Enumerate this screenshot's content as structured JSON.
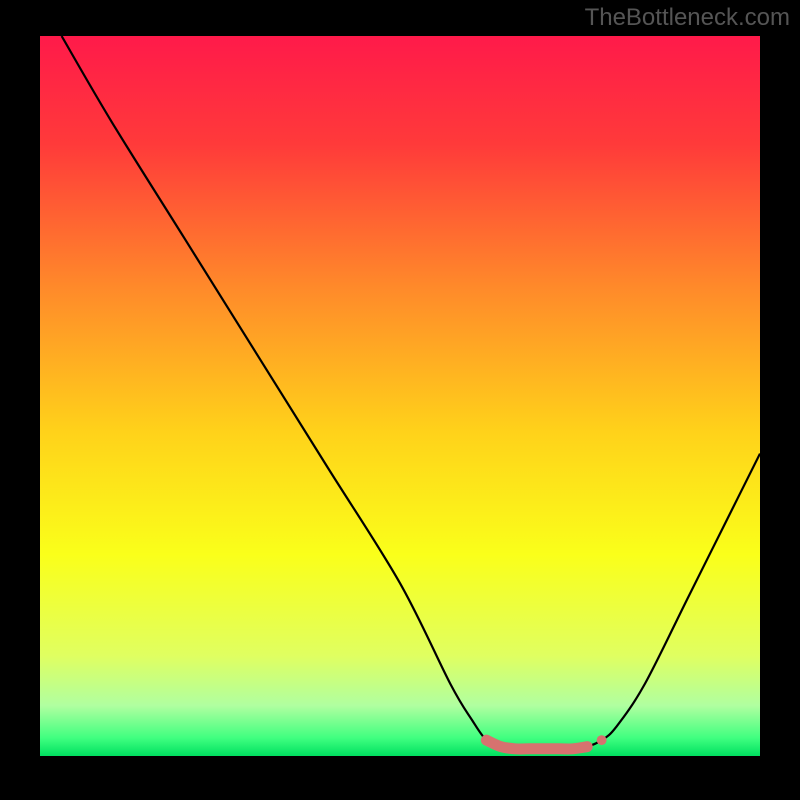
{
  "watermark": "TheBottleneck.com",
  "chart_data": {
    "type": "line",
    "title": "",
    "xlabel": "",
    "ylabel": "",
    "xlim": [
      0,
      100
    ],
    "ylim": [
      0,
      100
    ],
    "background_gradient": {
      "stops": [
        {
          "offset": 0.0,
          "color": "#ff1a4a"
        },
        {
          "offset": 0.15,
          "color": "#ff3a3a"
        },
        {
          "offset": 0.35,
          "color": "#ff8a2a"
        },
        {
          "offset": 0.55,
          "color": "#ffd21a"
        },
        {
          "offset": 0.72,
          "color": "#faff1a"
        },
        {
          "offset": 0.86,
          "color": "#e0ff60"
        },
        {
          "offset": 0.93,
          "color": "#b0ffa0"
        },
        {
          "offset": 0.975,
          "color": "#40ff80"
        },
        {
          "offset": 1.0,
          "color": "#00e060"
        }
      ]
    },
    "series": [
      {
        "name": "bottleneck-curve",
        "color": "#000000",
        "width": 2.2,
        "points": [
          {
            "x": 3,
            "y": 100
          },
          {
            "x": 10,
            "y": 88
          },
          {
            "x": 20,
            "y": 72
          },
          {
            "x": 30,
            "y": 56
          },
          {
            "x": 40,
            "y": 40
          },
          {
            "x": 50,
            "y": 24
          },
          {
            "x": 57,
            "y": 10
          },
          {
            "x": 60,
            "y": 5
          },
          {
            "x": 62,
            "y": 2.2
          },
          {
            "x": 64,
            "y": 1.3
          },
          {
            "x": 66,
            "y": 1.0
          },
          {
            "x": 70,
            "y": 1.0
          },
          {
            "x": 74,
            "y": 1.0
          },
          {
            "x": 76,
            "y": 1.3
          },
          {
            "x": 78,
            "y": 2.2
          },
          {
            "x": 80,
            "y": 4
          },
          {
            "x": 84,
            "y": 10
          },
          {
            "x": 90,
            "y": 22
          },
          {
            "x": 95,
            "y": 32
          },
          {
            "x": 100,
            "y": 42
          }
        ]
      }
    ],
    "highlight_band": {
      "color": "#d6726f",
      "radius": 5.5,
      "points": [
        {
          "x": 62,
          "y": 2.2
        },
        {
          "x": 64,
          "y": 1.3
        },
        {
          "x": 66,
          "y": 1.0
        },
        {
          "x": 68,
          "y": 1.0
        },
        {
          "x": 70,
          "y": 1.0
        },
        {
          "x": 72,
          "y": 1.0
        },
        {
          "x": 74,
          "y": 1.0
        },
        {
          "x": 76,
          "y": 1.3
        }
      ],
      "end_dot": {
        "x": 78,
        "y": 2.2
      }
    }
  }
}
